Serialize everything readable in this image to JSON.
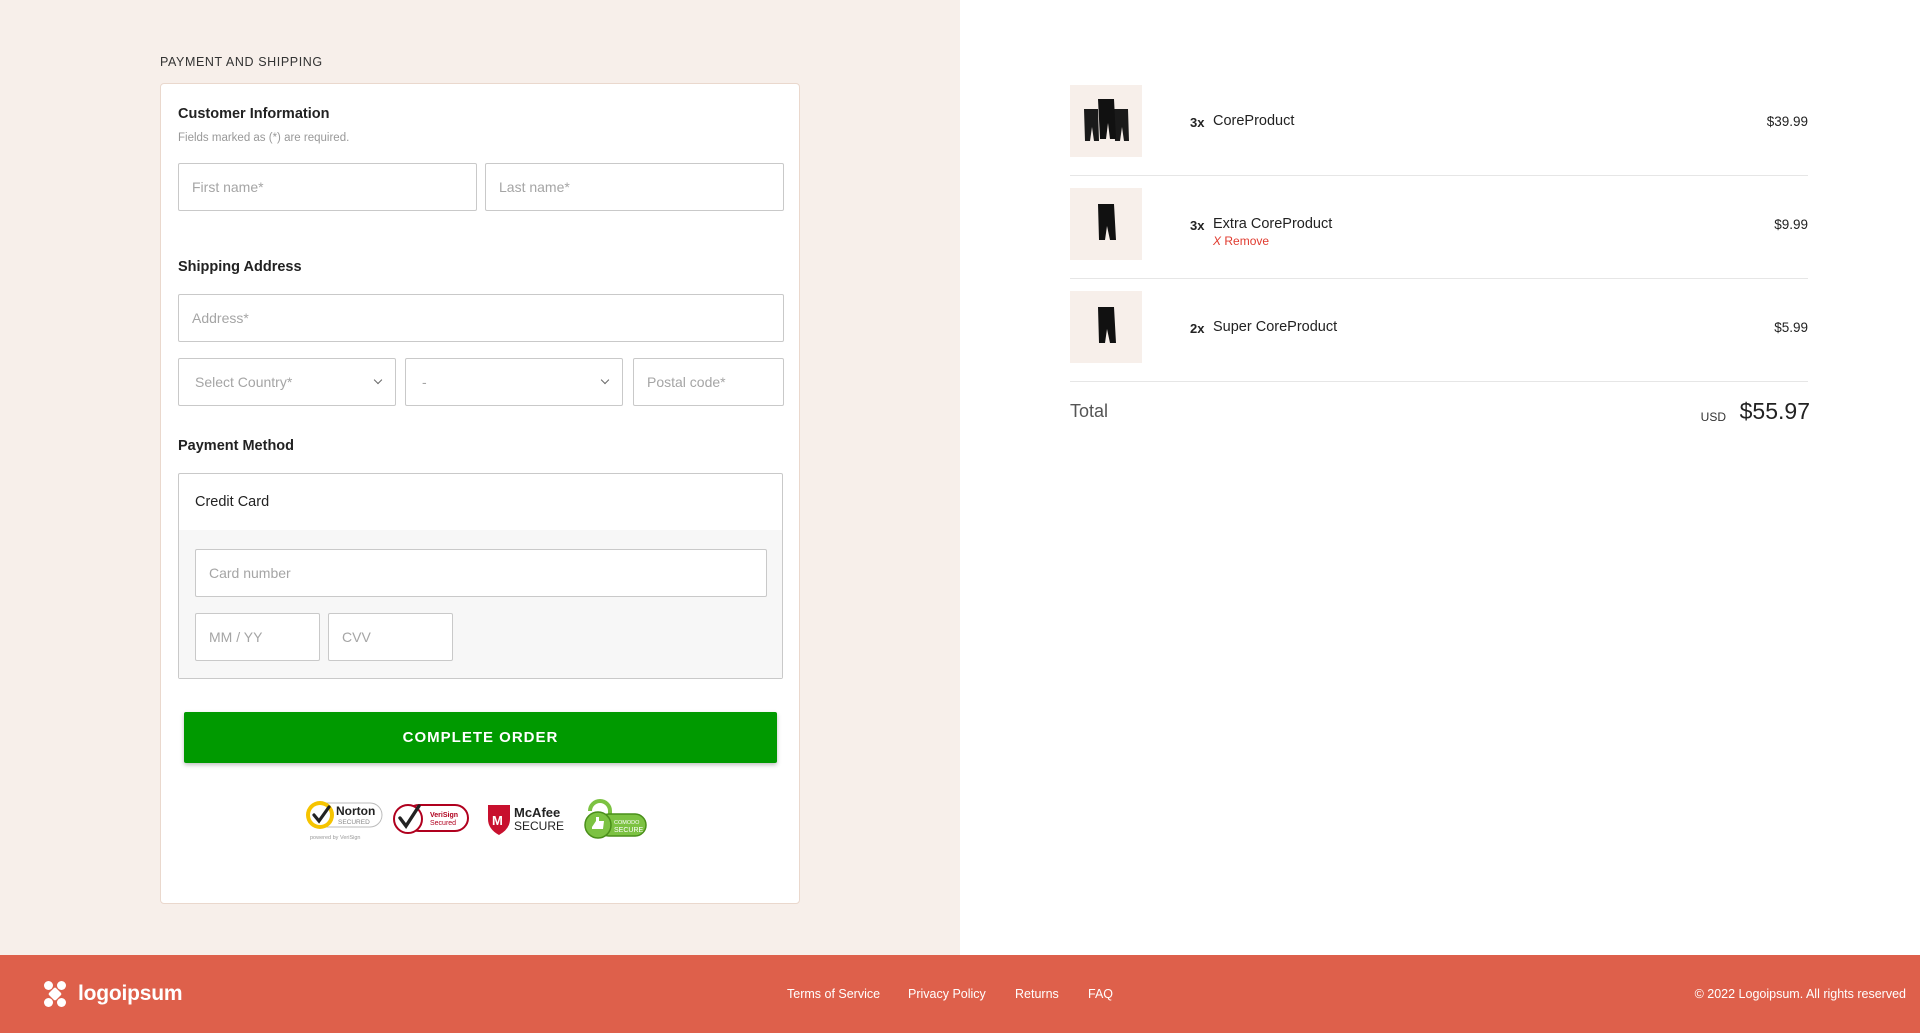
{
  "checkout": {
    "section_heading": "PAYMENT AND SHIPPING",
    "customer_info": {
      "title": "Customer Information",
      "hint": "Fields marked as (*) are required.",
      "first_name_placeholder": "First name*",
      "last_name_placeholder": "Last name*"
    },
    "shipping": {
      "title": "Shipping Address",
      "address_placeholder": "Address*",
      "country_select": "Select Country*",
      "region_select": "-",
      "postal_placeholder": "Postal code*"
    },
    "payment": {
      "title": "Payment Method",
      "method_label": "Credit Card",
      "card_number_placeholder": "Card number",
      "expiry_placeholder": "MM / YY",
      "cvv_placeholder": "CVV"
    },
    "complete_button": "COMPLETE ORDER",
    "badges": {
      "norton_title": "Norton",
      "norton_sub": "SECURED",
      "norton_powered": "powered by VeriSign",
      "verisign_line1": "VeriSign",
      "verisign_line2": "Secured",
      "mcafee_title": "McAfee",
      "mcafee_sub": "SECURE",
      "comodo_line1": "COMODO",
      "comodo_line2": "SECURE"
    }
  },
  "order": {
    "items": [
      {
        "qty": "3x",
        "name": "CoreProduct",
        "price": "$39.99",
        "remove": ""
      },
      {
        "qty": "3x",
        "name": "Extra CoreProduct",
        "price": "$9.99",
        "remove_x": "X",
        "remove": "Remove"
      },
      {
        "qty": "2x",
        "name": "Super CoreProduct",
        "price": "$5.99",
        "remove": ""
      }
    ],
    "total_label": "Total",
    "total_currency": "USD",
    "total_amount": "$55.97"
  },
  "footer": {
    "logo_text": "logoipsum",
    "links": [
      "Terms of Service",
      "Privacy Policy",
      "Returns",
      "FAQ"
    ],
    "copyright": "© 2022 Logoipsum. All rights reserved"
  },
  "colors": {
    "left_bg": "#f7efea",
    "accent_green": "#009a00",
    "footer_bg": "#de604b",
    "remove_red": "#e03b2f"
  }
}
